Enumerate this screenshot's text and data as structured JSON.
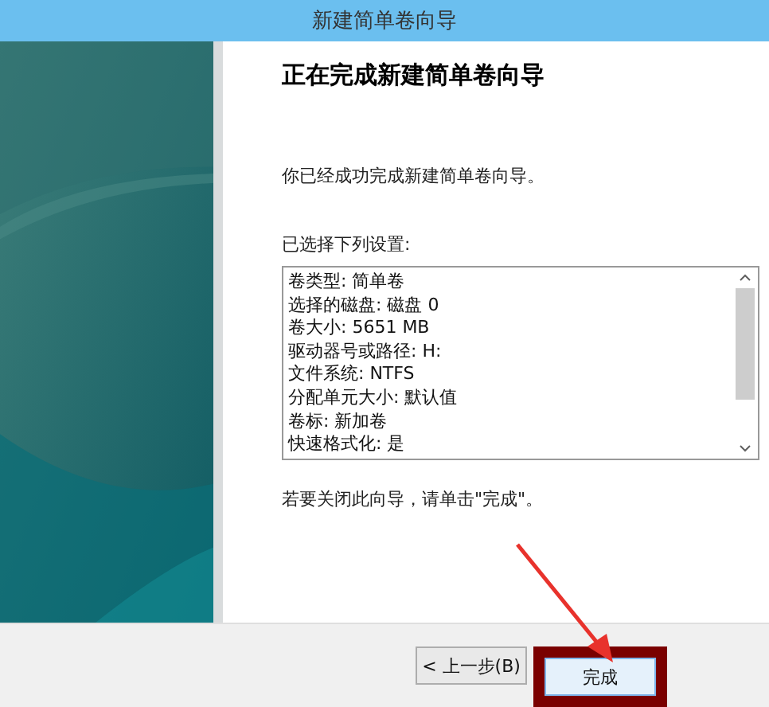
{
  "window": {
    "title": "新建简单卷向导"
  },
  "heading": "正在完成新建简单卷向导",
  "intro": "你已经成功完成新建简单卷向导。",
  "settings_label": "已选择下列设置:",
  "settings": [
    "卷类型: 简单卷",
    "选择的磁盘: 磁盘 0",
    "卷大小: 5651 MB",
    "驱动器号或路径: H:",
    "文件系统: NTFS",
    "分配单元大小: 默认值",
    "卷标: 新加卷",
    "快速格式化: 是"
  ],
  "closing_text": "若要关闭此向导，请单击\"完成\"。",
  "buttons": [
    {
      "label": "< 上一步(B)",
      "kind": "back"
    },
    {
      "label": "完成",
      "kind": "finish"
    }
  ]
}
